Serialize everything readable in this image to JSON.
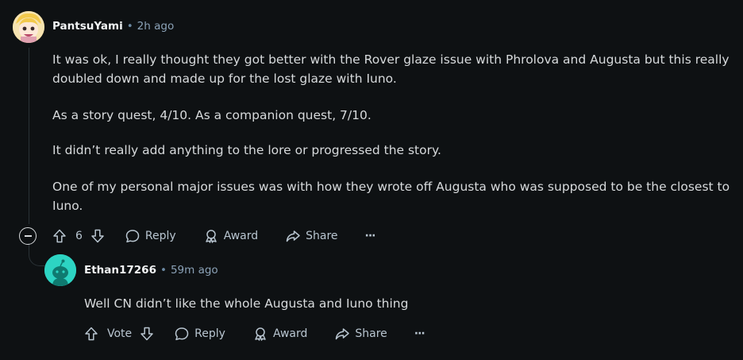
{
  "comments": [
    {
      "author": "PantsuYami",
      "separator": "•",
      "time": "2h ago",
      "paragraphs": [
        "It was ok, I really thought they got better with the Rover glaze issue with Phrolova and Augusta but this really doubled down and made up for the lost glaze with Iuno.",
        "As a story quest, 4/10. As a companion quest, 7/10.",
        "It didn’t really add anything to the lore or progressed the story.",
        "One of my personal major issues was with how they wrote off Augusta who was supposed to be the closest to Iuno."
      ],
      "actions": {
        "vote_count": "6",
        "reply_label": "Reply",
        "award_label": "Award",
        "share_label": "Share",
        "more_label": "···"
      }
    },
    {
      "author": "Ethan17266",
      "separator": "•",
      "time": "59m ago",
      "paragraphs": [
        "Well CN didn’t like the whole Augusta and Iuno thing"
      ],
      "actions": {
        "vote_label": "Vote",
        "reply_label": "Reply",
        "award_label": "Award",
        "share_label": "Share",
        "more_label": "···"
      }
    }
  ],
  "icons": {
    "collapse": "collapse-icon",
    "upvote": "upvote-icon",
    "downvote": "downvote-icon",
    "reply": "comment-bubble-icon",
    "award": "award-icon",
    "share": "share-icon",
    "more": "more-horizontal-icon"
  },
  "colors": {
    "background": "#0e1113",
    "text": "#d7dadc",
    "meta": "#8ba2b7",
    "avatar_1": "#f3d27a",
    "avatar_2": "#2dd4c3"
  }
}
